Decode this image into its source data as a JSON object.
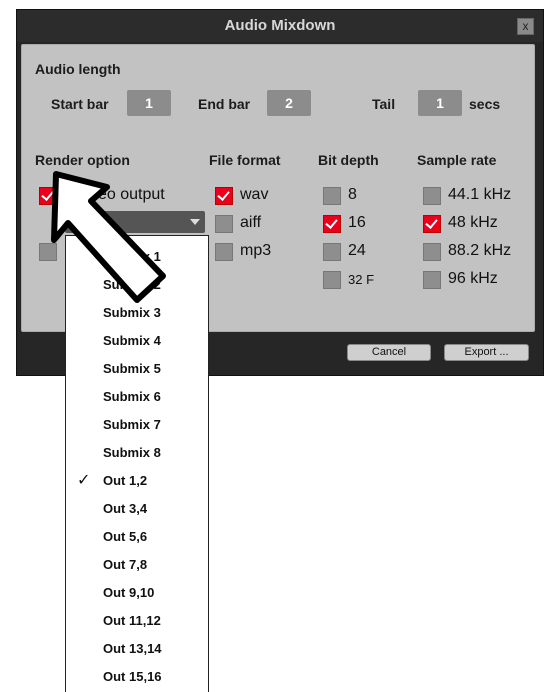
{
  "window": {
    "title": "Audio Mixdown",
    "close_label": "x"
  },
  "audio_length": {
    "heading": "Audio length",
    "start_label": "Start bar",
    "start_value": "1",
    "end_label": "End bar",
    "end_value": "2",
    "tail_label": "Tail",
    "tail_value": "1",
    "tail_unit": "secs"
  },
  "headers": {
    "render": "Render option",
    "format": "File format",
    "bitdepth": "Bit depth",
    "samplerate": "Sample rate"
  },
  "render": {
    "stereo_checked": true,
    "stereo_label_visible": "eo output",
    "output_select_visible": "2",
    "second_checked": false
  },
  "formats": [
    {
      "label": "wav",
      "checked": true
    },
    {
      "label": "aiff",
      "checked": false
    },
    {
      "label": "mp3",
      "checked": false
    }
  ],
  "bitdepths": [
    {
      "label": "8",
      "checked": false
    },
    {
      "label": "16",
      "checked": true
    },
    {
      "label": "24",
      "checked": false
    },
    {
      "label": "32 F",
      "checked": false
    }
  ],
  "samplerates": [
    {
      "label": "44.1 kHz",
      "checked": false
    },
    {
      "label": "48 kHz",
      "checked": true
    },
    {
      "label": "88.2 kHz",
      "checked": false
    },
    {
      "label": "96 kHz",
      "checked": false
    }
  ],
  "buttons": {
    "cancel": "Cancel",
    "export": "Export ..."
  },
  "menu": {
    "items": [
      {
        "label": "Submix 1",
        "checked": false
      },
      {
        "label": "Submix 2",
        "checked": false
      },
      {
        "label": "Submix 3",
        "checked": false
      },
      {
        "label": "Submix 4",
        "checked": false
      },
      {
        "label": "Submix 5",
        "checked": false
      },
      {
        "label": "Submix 6",
        "checked": false
      },
      {
        "label": "Submix 7",
        "checked": false
      },
      {
        "label": "Submix 8",
        "checked": false
      },
      {
        "label": "Out 1,2",
        "checked": true
      },
      {
        "label": "Out 3,4",
        "checked": false
      },
      {
        "label": "Out 5,6",
        "checked": false
      },
      {
        "label": "Out 7,8",
        "checked": false
      },
      {
        "label": "Out 9,10",
        "checked": false
      },
      {
        "label": "Out 11,12",
        "checked": false
      },
      {
        "label": "Out 13,14",
        "checked": false
      },
      {
        "label": "Out 15,16",
        "checked": false
      }
    ]
  },
  "colors": {
    "checkbox_on": "#e8001c",
    "panel": "#c2c2c2",
    "frame": "#262626"
  }
}
